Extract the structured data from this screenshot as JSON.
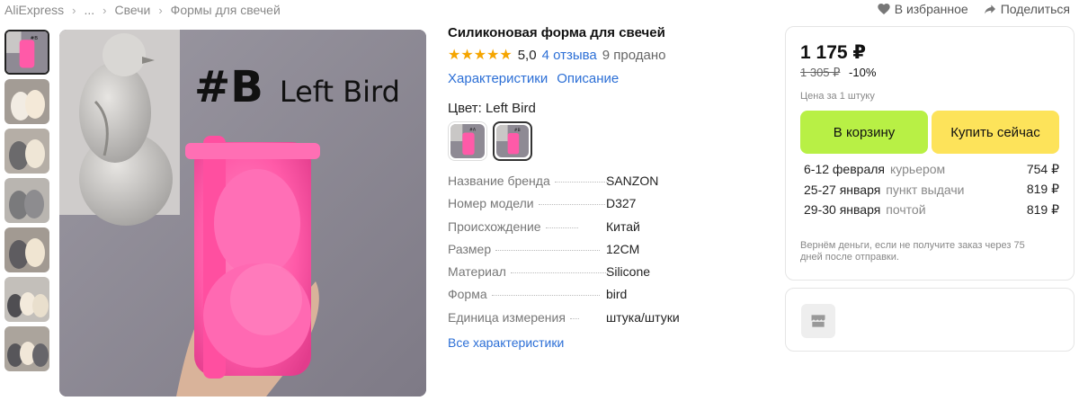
{
  "breadcrumb": {
    "items": [
      "AliExpress",
      "...",
      "Свечи",
      "Формы для свечей"
    ]
  },
  "top_actions": {
    "favorite": "В избранное",
    "share": "Поделиться",
    "favorite_icon": "heart-icon",
    "share_icon": "share-icon"
  },
  "gallery": {
    "thumbnail_count": 7,
    "active_index": 0,
    "main_image_text_big": "#B",
    "main_image_text_small": "Left Bird"
  },
  "product": {
    "title": "Силиконовая форма для свечей",
    "rating": "5,0",
    "stars": "★★★★★",
    "reviews": "4 отзыва",
    "sold": "9 продано",
    "tabs": [
      "Характеристики",
      "Описание"
    ],
    "color_label": "Цвет: Left Bird",
    "specs": [
      {
        "key": "Название бренда",
        "value": "SANZON"
      },
      {
        "key": "Номер модели",
        "value": "D327"
      },
      {
        "key": "Происхождение",
        "value": "Китай"
      },
      {
        "key": "Размер",
        "value": "12CM"
      },
      {
        "key": "Материал",
        "value": "Silicone"
      },
      {
        "key": "Форма",
        "value": "bird"
      },
      {
        "key": "Единица измерения",
        "value": "штука/штуки"
      }
    ],
    "all_specs_link": "Все характеристики"
  },
  "buybox": {
    "price": "1 175 ₽",
    "old_price": "1 305 ₽",
    "discount": "-10%",
    "per_unit": "Цена за 1 штуку",
    "add_to_cart": "В корзину",
    "buy_now": "Купить сейчас",
    "delivery": [
      {
        "date": "6-12 февраля",
        "method": "курьером",
        "cost": "754 ₽"
      },
      {
        "date": "25-27 января",
        "method": "пункт выдачи",
        "cost": "819 ₽"
      },
      {
        "date": "29-30 января",
        "method": "почтой",
        "cost": "819 ₽"
      }
    ],
    "refund_note": "Вернём деньги, если не получите заказ через 75 дней после отправки."
  },
  "colors": {
    "accent_link": "#2c6fd6",
    "star": "#f5a500",
    "cart_button": "#b8f045",
    "buy_button": "#fde35a",
    "mold_pink": "#ff5aa8"
  }
}
